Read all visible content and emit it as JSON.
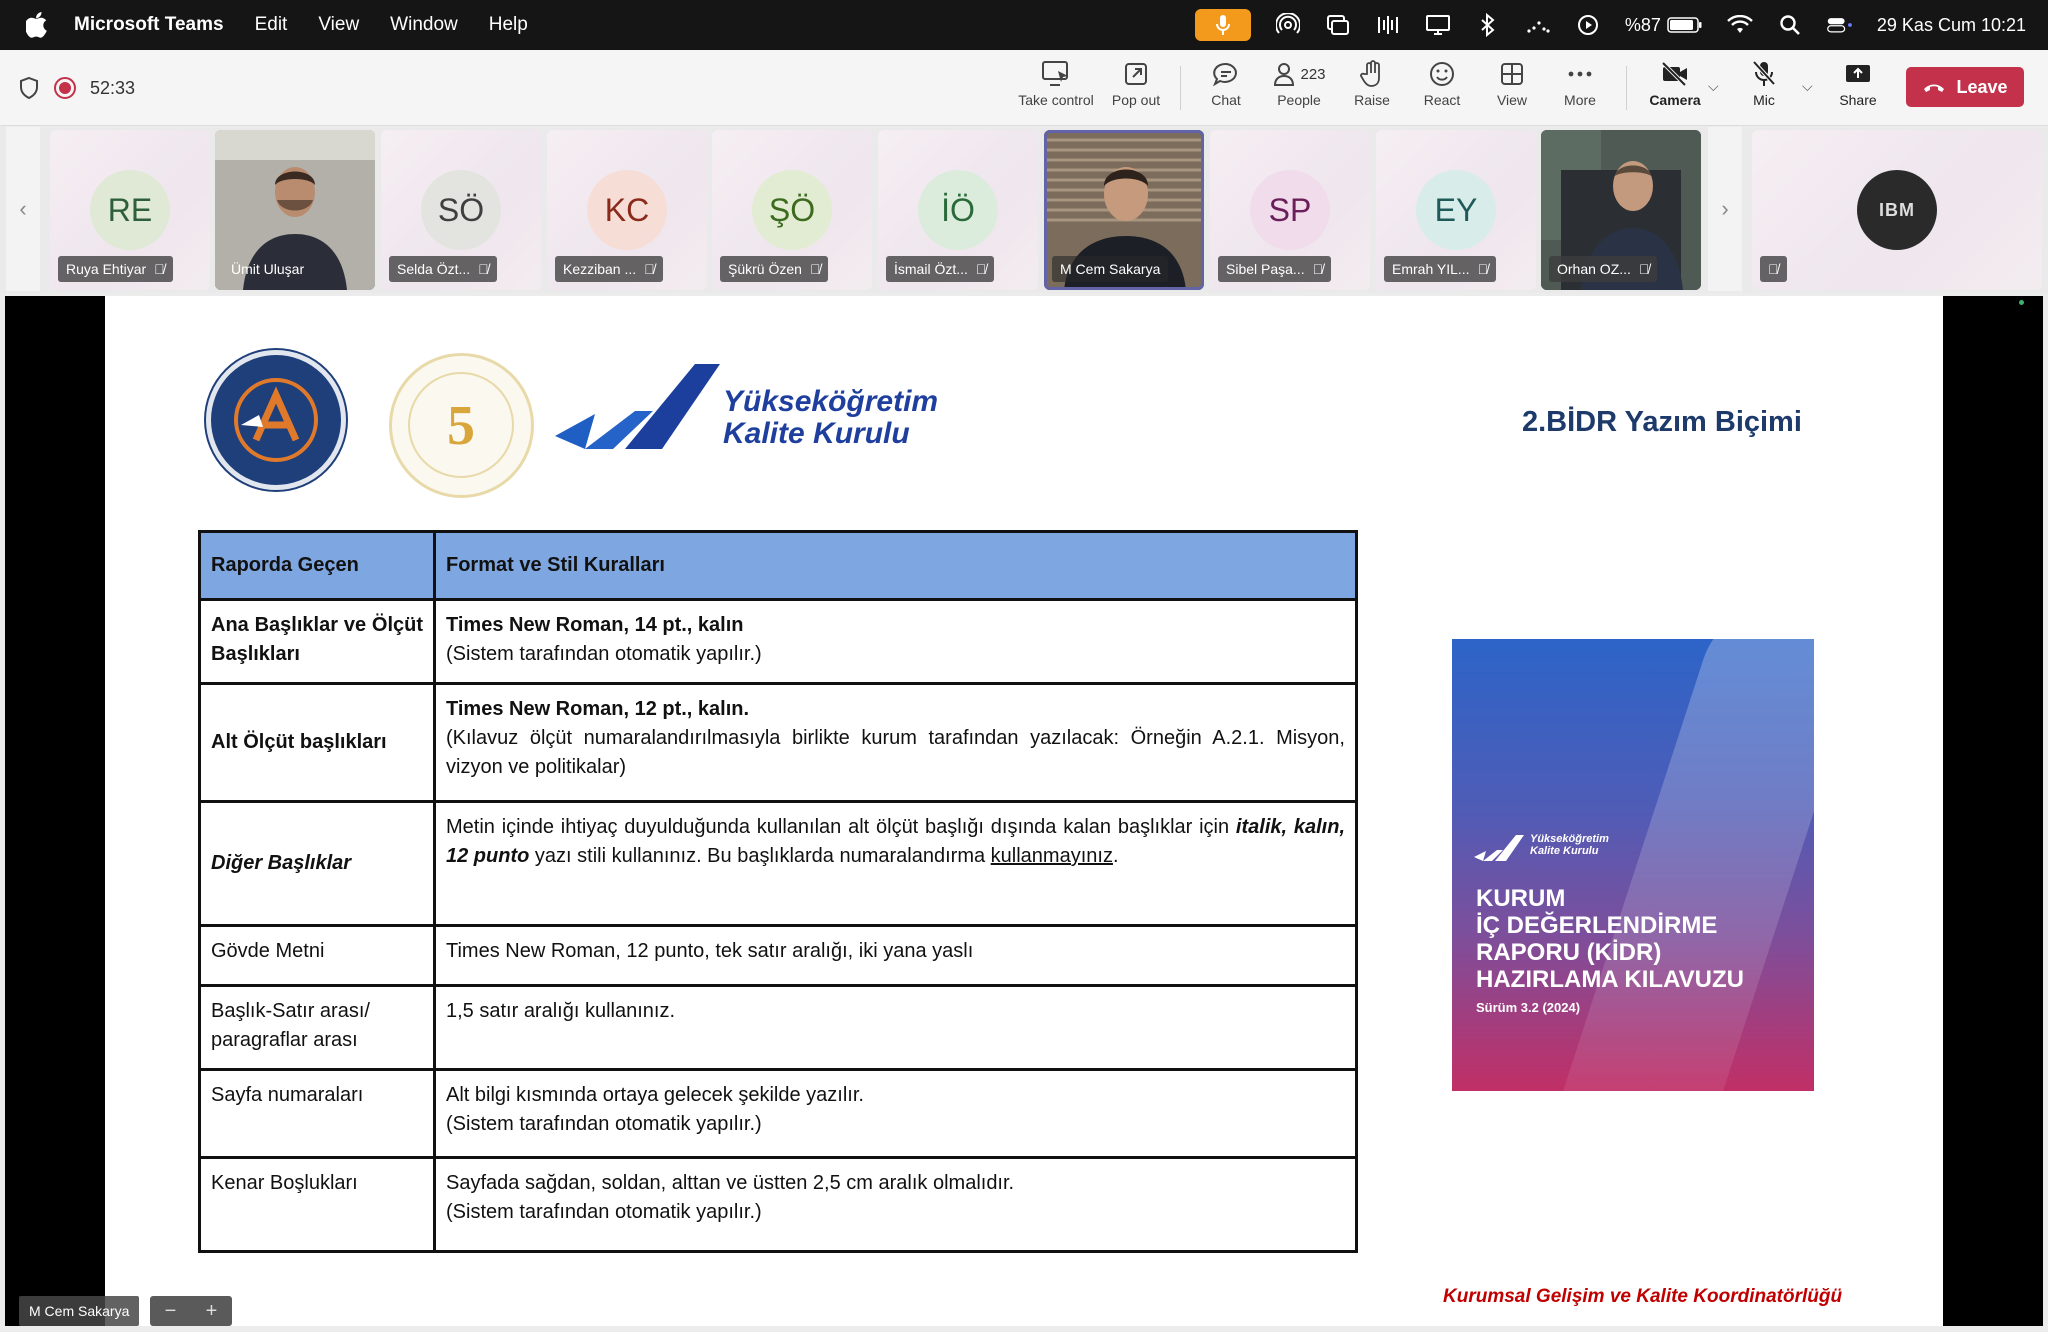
{
  "menubar": {
    "app_name": "Microsoft Teams",
    "menus": [
      "Edit",
      "View",
      "Window",
      "Help"
    ],
    "battery": "%87",
    "datetime": "29 Kas Cum  10:21"
  },
  "toolbar": {
    "timer": "52:33",
    "buttons": {
      "take_control": "Take control",
      "pop_out": "Pop out",
      "chat": "Chat",
      "people": "People",
      "people_count": "223",
      "raise": "Raise",
      "react": "React",
      "view": "View",
      "more": "More",
      "camera": "Camera",
      "mic": "Mic",
      "share": "Share",
      "leave": "Leave"
    }
  },
  "participants": [
    {
      "initials": "RE",
      "name": "Ruya Ehtiyar",
      "muted": true,
      "color": "#2f5f3a",
      "bg": "#dfe9d6"
    },
    {
      "initials": "",
      "name": "Ümit Uluşar",
      "muted": false,
      "video": true
    },
    {
      "initials": "SÖ",
      "name": "Selda Özt...",
      "muted": true,
      "color": "#3f3f3f",
      "bg": "#e3e3df"
    },
    {
      "initials": "KC",
      "name": "Kezziban ...",
      "muted": true,
      "color": "#8a2a1a",
      "bg": "#f6ddd6"
    },
    {
      "initials": "ŞÖ",
      "name": "Şükrü Özen",
      "muted": true,
      "color": "#3c6a1f",
      "bg": "#e2ecd2"
    },
    {
      "initials": "İÖ",
      "name": "İsmail Özt...",
      "muted": true,
      "color": "#2a6a3a",
      "bg": "#dcecdc"
    },
    {
      "initials": "",
      "name": "M Cem Sakarya",
      "muted": false,
      "video": true,
      "active": true
    },
    {
      "initials": "SP",
      "name": "Sibel Paşa...",
      "muted": true,
      "color": "#6a1f5a",
      "bg": "#f1dcec"
    },
    {
      "initials": "EY",
      "name": "Emrah YIL...",
      "muted": true,
      "color": "#1f5a5a",
      "bg": "#d8ece9"
    },
    {
      "initials": "",
      "name": "Orhan OZ...",
      "muted": true,
      "video": true
    },
    {
      "initials": "",
      "name": "",
      "muted": true,
      "ibm": true
    }
  ],
  "slide": {
    "title": "2.BİDR Yazım Biçimi",
    "yok_logo_line1": "Yükseköğretim",
    "yok_logo_line2": "Kalite Kurulu",
    "table": {
      "headers": [
        "Raporda Geçen",
        "Format ve Stil Kuralları"
      ],
      "rows": [
        {
          "label": "Ana Başlıklar ve Ölçüt Başlıkları",
          "line1": "Times New Roman, 14 pt., kalın",
          "line2": "(Sistem tarafından otomatik yapılır.)"
        },
        {
          "label": "Alt Ölçüt başlıkları",
          "line1": "Times New Roman, 12 pt., kalın.",
          "line2": "(Kılavuz ölçüt numaralandırılmasıyla birlikte kurum tarafından yazılacak: Örneğin  A.2.1. Misyon, vizyon ve politikalar)"
        },
        {
          "label": "Diğer Başlıklar",
          "p1": "Metin içinde ihtiyaç duyulduğunda kullanılan alt ölçüt başlığı dışında kalan başlıklar için ",
          "p2": "italik, kalın, 12 punto",
          "p3": " yazı stili kullanınız. Bu başlıklarda numaralandırma ",
          "p4": "kullanmayınız",
          "p5": "."
        },
        {
          "label": "Gövde Metni",
          "line1": "Times New Roman, 12 punto, tek satır aralığı, iki yana yaslı"
        },
        {
          "label": "Başlık-Satır arası/ paragraflar arası",
          "line1": "1,5 satır aralığı kullanınız."
        },
        {
          "label": "Sayfa numaraları",
          "line1": "Alt bilgi kısmında ortaya gelecek şekilde yazılır.",
          "line2": "(Sistem tarafından otomatik yapılır.)"
        },
        {
          "label": "Kenar Boşlukları",
          "line1": "Sayfada sağdan, soldan, alttan ve üstten 2,5 cm aralık olmalıdır.",
          "line2": "(Sistem tarafından otomatik yapılır.)"
        }
      ]
    },
    "cover": {
      "brand1": "Yükseköğretim",
      "brand2": "Kalite Kurulu",
      "title1": "KURUM",
      "title2": "İÇ DEĞERLENDİRME",
      "title3": "RAPORU (KİDR)",
      "title4": "HAZIRLAMA KILAVUZU",
      "version": "Sürüm 3.2 (2024)"
    },
    "footer": "Kurumsal Gelişim ve Kalite Koordinatörlüğü"
  },
  "stage": {
    "speaker_label": "M Cem Sakarya"
  },
  "colors": {
    "leave": "#c4314b",
    "table_header": "#7ea6e0",
    "title": "#1d3a6b",
    "footer": "#c00000"
  }
}
